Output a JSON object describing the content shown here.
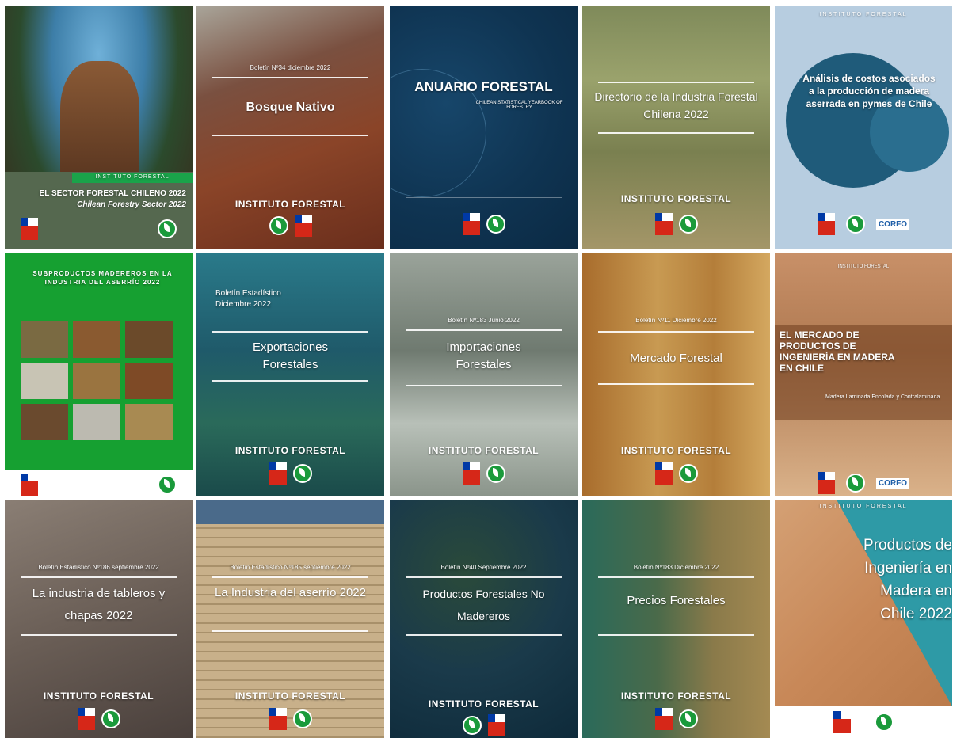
{
  "covers": [
    {
      "id": "c1",
      "band": "INSTITUTO FORESTAL",
      "title": "EL SECTOR FORESTAL CHILENO 2022",
      "subtitle": "Chilean Forestry Sector 2022"
    },
    {
      "id": "c2",
      "issue": "Boletín Nº34 diciembre 2022",
      "title": "Bosque Nativo",
      "inst": "INSTITUTO FORESTAL"
    },
    {
      "id": "c3",
      "title": "ANUARIO FORESTAL",
      "subtitle": "CHILEAN STATISTICAL YEARBOOK OF FORESTRY"
    },
    {
      "id": "c4",
      "title": "Directorio de la Industria Forestal Chilena 2022",
      "inst": "INSTITUTO FORESTAL"
    },
    {
      "id": "c5",
      "band": "INSTITUTO FORESTAL",
      "title": "Análisis de costos asociados a la producción de madera aserrada en pymes de Chile",
      "corfo": "CORFO"
    },
    {
      "id": "c6",
      "title": "SUBPRODUCTOS MADEREROS EN LA INDUSTRIA DEL ASERRÍO 2022"
    },
    {
      "id": "c7",
      "issue": "Boletín Estadístico Diciembre 2022",
      "title": "Exportaciones Forestales",
      "inst": "INSTITUTO FORESTAL"
    },
    {
      "id": "c8",
      "issue": "Boletín Nº183 Junio 2022",
      "title": "Importaciones Forestales",
      "inst": "INSTITUTO FORESTAL"
    },
    {
      "id": "c9",
      "issue": "Boletín Nº11 Diciembre 2022",
      "title": "Mercado Forestal",
      "inst": "INSTITUTO FORESTAL"
    },
    {
      "id": "c10",
      "band": "INSTITUTO FORESTAL",
      "title": "EL MERCADO DE PRODUCTOS DE INGENIERÍA EN MADERA EN CHILE",
      "subtitle": "Madera Laminada Encolada y Contralaminada",
      "corfo": "CORFO"
    },
    {
      "id": "c11",
      "issue": "Boletín Estadístico Nº186 septiembre 2022",
      "title": "La industria de tableros y chapas 2022",
      "inst": "INSTITUTO FORESTAL"
    },
    {
      "id": "c12",
      "issue": "Boletín Estadístico Nº185 septiembre 2022",
      "title": "La Industria del aserrío 2022",
      "inst": "INSTITUTO FORESTAL"
    },
    {
      "id": "c13",
      "issue": "Boletín Nº40 Septiembre 2022",
      "title": "Productos Forestales No Madereros",
      "inst": "INSTITUTO FORESTAL"
    },
    {
      "id": "c14",
      "issue": "Boletín Nº183 Diciembre 2022",
      "title": "Precios Forestales",
      "inst": "INSTITUTO FORESTAL"
    },
    {
      "id": "c15",
      "band": "INSTITUTO FORESTAL",
      "title": "Productos de Ingeniería en Madera en Chile 2022"
    }
  ]
}
